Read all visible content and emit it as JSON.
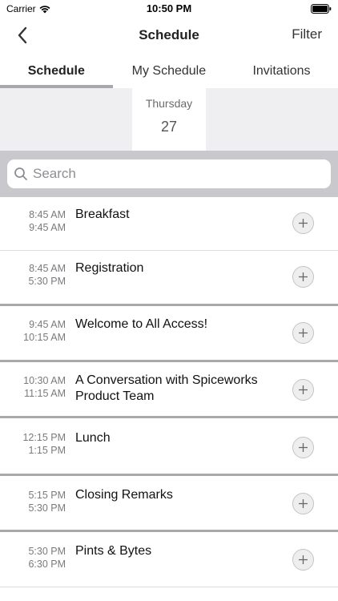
{
  "status_bar": {
    "carrier": "Carrier",
    "time": "10:50 PM",
    "wifi_icon": "wifi-icon",
    "battery_icon": "battery-icon"
  },
  "nav": {
    "back_icon": "chevron-left-icon",
    "title": "Schedule",
    "filter_label": "Filter"
  },
  "tabs": [
    {
      "label": "Schedule",
      "active": true
    },
    {
      "label": "My Schedule",
      "active": false
    },
    {
      "label": "Invitations",
      "active": false
    }
  ],
  "date": {
    "weekday": "Thursday",
    "day": "27"
  },
  "search": {
    "placeholder": "Search",
    "value": ""
  },
  "sessions": [
    {
      "start": "8:45 AM",
      "end": "9:45 AM",
      "title": "Breakfast"
    },
    {
      "start": "8:45 AM",
      "end": "5:30 PM",
      "title": "Registration"
    },
    {
      "start": "9:45 AM",
      "end": "10:15 AM",
      "title": "Welcome to All Access!"
    },
    {
      "start": "10:30 AM",
      "end": "11:15 AM",
      "title": "A Conversation with Spiceworks Product Team"
    },
    {
      "start": "12:15 PM",
      "end": "1:15 PM",
      "title": "Lunch"
    },
    {
      "start": "5:15 PM",
      "end": "5:30 PM",
      "title": "Closing Remarks"
    },
    {
      "start": "5:30 PM",
      "end": "6:30 PM",
      "title": "Pints & Bytes"
    }
  ],
  "colors": {
    "accent_tab_underline": "#a8a8ac",
    "date_strip_bg": "#efeff1",
    "search_bar_bg": "#c8c8cd",
    "divider": "#a9a9ad"
  }
}
